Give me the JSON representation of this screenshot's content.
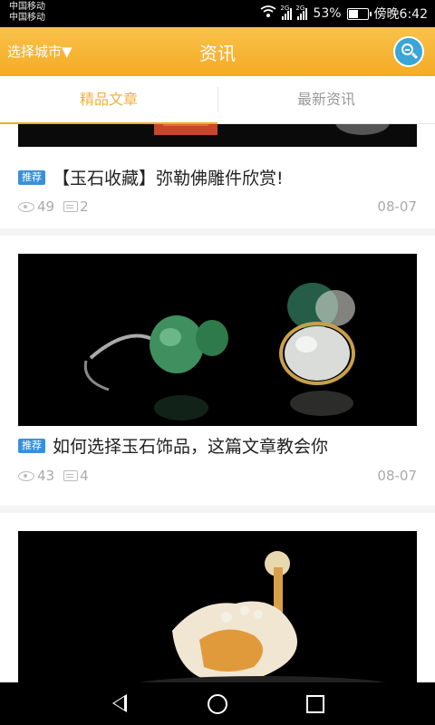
{
  "statusbar": {
    "carrier1": "中国移动",
    "carrier2": "中国移动",
    "net1": "2G",
    "net2": "2G",
    "battery": "53%",
    "time": "傍晚6:42"
  },
  "header": {
    "city_label": "选择城市▼",
    "title": "资讯",
    "search_icon": "search-icon"
  },
  "tabs": [
    {
      "label": "精品文章",
      "active": true
    },
    {
      "label": "最新资讯",
      "active": false
    }
  ],
  "articles": [
    {
      "tag": "推荐",
      "title": "【玉石收藏】弥勒佛雕件欣赏!",
      "views": "49",
      "comments": "2",
      "date": "08-07"
    },
    {
      "tag": "推荐",
      "title": "如何选择玉石饰品，这篇文章教会你",
      "views": "43",
      "comments": "4",
      "date": "08-07"
    }
  ],
  "colors": {
    "accent": "#f5aa24",
    "tag": "#3b8fd8",
    "search": "#3aa5d7"
  }
}
